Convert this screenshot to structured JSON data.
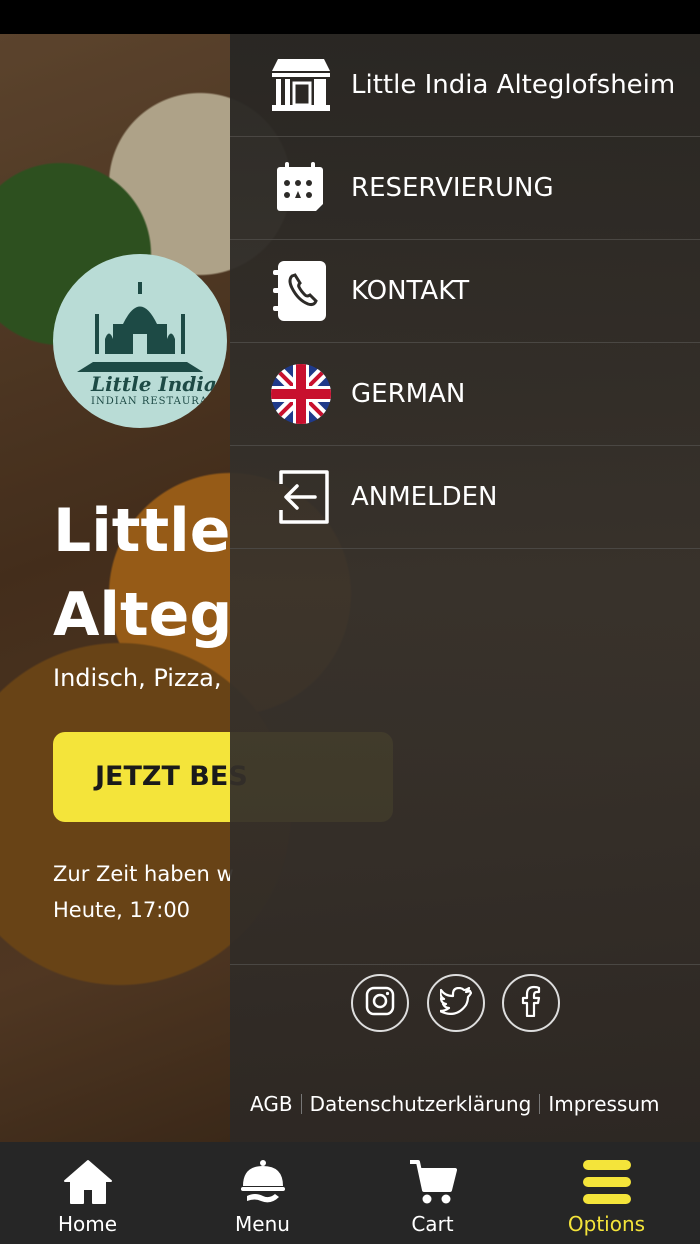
{
  "background": {
    "logo_script": "Little India",
    "logo_subtitle": "INDIAN RESTAURANT",
    "title_line1": "Little",
    "title_line2": "Alteg",
    "subtitle": "Indisch, Pizza,",
    "order_button": "JETZT BES",
    "closed_line1": "Zur Zeit haben w",
    "closed_line2": "Heute, 17:00"
  },
  "drawer": {
    "items": [
      {
        "label": "Little India Alteglofsheim",
        "icon": "restaurant-icon"
      },
      {
        "label": "RESERVIERUNG",
        "icon": "calendar-icon"
      },
      {
        "label": "KONTAKT",
        "icon": "phone-book-icon"
      },
      {
        "label": "GERMAN",
        "icon": "uk-flag-icon"
      },
      {
        "label": "ANMELDEN",
        "icon": "login-icon"
      }
    ],
    "social": [
      "instagram-icon",
      "twitter-icon",
      "facebook-icon"
    ],
    "footer": {
      "agb": "AGB",
      "privacy": "Datenschutzerklärung",
      "imprint": "Impressum"
    }
  },
  "bottom_nav": {
    "items": [
      {
        "label": "Home",
        "icon": "home-icon"
      },
      {
        "label": "Menu",
        "icon": "serving-dish-icon"
      },
      {
        "label": "Cart",
        "icon": "cart-icon"
      },
      {
        "label": "Options",
        "icon": "menu-bars-icon"
      }
    ],
    "active_color": "#f4e43a"
  }
}
